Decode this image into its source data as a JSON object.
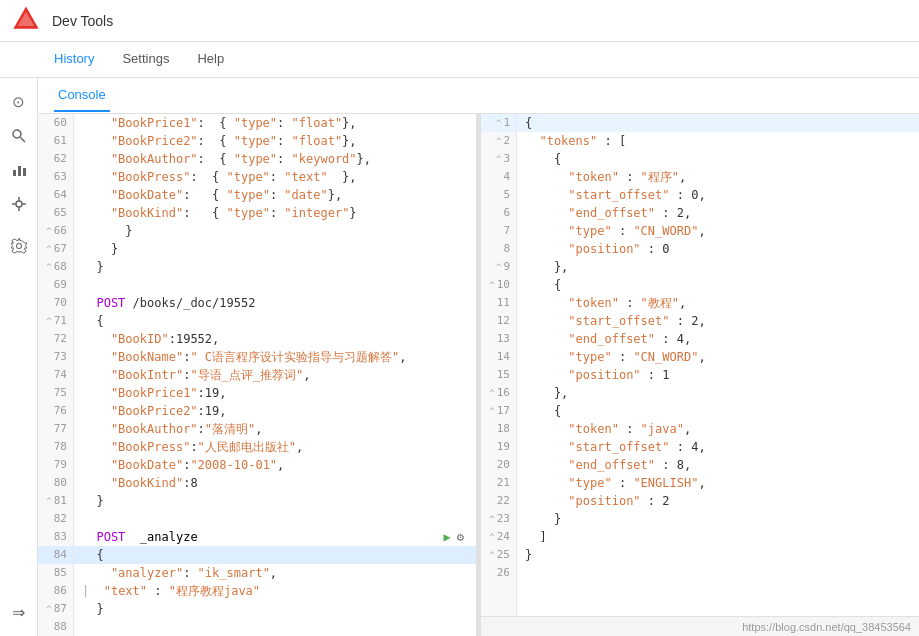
{
  "topbar": {
    "title": "Dev Tools"
  },
  "nav": {
    "items": [
      {
        "label": "History",
        "active": true
      },
      {
        "label": "Settings",
        "active": false
      },
      {
        "label": "Help",
        "active": false
      }
    ]
  },
  "sidebar": {
    "icons": [
      {
        "name": "clock-icon",
        "symbol": "⊙",
        "active": false
      },
      {
        "name": "search-icon",
        "symbol": "⌕",
        "active": false
      },
      {
        "name": "chart-icon",
        "symbol": "⊞",
        "active": false
      },
      {
        "name": "wrench-icon",
        "symbol": "⚙",
        "active": false
      },
      {
        "name": "settings-icon",
        "symbol": "⚙",
        "active": false
      }
    ],
    "bottom_icon": {
      "name": "arrow-right-icon",
      "symbol": "⇒"
    }
  },
  "console": {
    "tab_label": "Console"
  },
  "left_editor": {
    "lines": [
      {
        "num": 60,
        "arrow": null,
        "code": "    \"BookPrice1\":  { \"type\": \"float\"},"
      },
      {
        "num": 61,
        "arrow": null,
        "code": "    \"BookPrice2\":  { \"type\": \"float\"},"
      },
      {
        "num": 62,
        "arrow": null,
        "code": "    \"BookAuthor\":  { \"type\": \"keyword\"},"
      },
      {
        "num": 63,
        "arrow": null,
        "code": "    \"BookPress\":  { \"type\": \"text\"  },"
      },
      {
        "num": 64,
        "arrow": null,
        "code": "    \"BookDate\":   { \"type\": \"date\"},"
      },
      {
        "num": 65,
        "arrow": null,
        "code": "    \"BookKind\":   { \"type\": \"integer\"}"
      },
      {
        "num": 66,
        "arrow": "^",
        "code": "      }"
      },
      {
        "num": 67,
        "arrow": "^",
        "code": "    }"
      },
      {
        "num": 68,
        "arrow": "^",
        "code": "  }"
      },
      {
        "num": 69,
        "arrow": null,
        "code": ""
      },
      {
        "num": 70,
        "arrow": null,
        "code": "  POST /books/_doc/19552"
      },
      {
        "num": 71,
        "arrow": "^",
        "code": "  {"
      },
      {
        "num": 72,
        "arrow": null,
        "code": "    \"BookID\":19552,"
      },
      {
        "num": 73,
        "arrow": null,
        "code": "    \"BookName\":\" C语言程序设计实验指导与习题解答\","
      },
      {
        "num": 74,
        "arrow": null,
        "code": "    \"BookIntr\":\"导语_点评_推荐词\","
      },
      {
        "num": 75,
        "arrow": null,
        "code": "    \"BookPrice1\":19,"
      },
      {
        "num": 76,
        "arrow": null,
        "code": "    \"BookPrice2\":19,"
      },
      {
        "num": 77,
        "arrow": null,
        "code": "    \"BookAuthor\":\"落清明\","
      },
      {
        "num": 78,
        "arrow": null,
        "code": "    \"BookPress\":\"人民邮电出版社\","
      },
      {
        "num": 79,
        "arrow": null,
        "code": "    \"BookDate\":\"2008-10-01\","
      },
      {
        "num": 80,
        "arrow": null,
        "code": "    \"BookKind\":8"
      },
      {
        "num": 81,
        "arrow": "^",
        "code": "  }"
      },
      {
        "num": 82,
        "arrow": null,
        "code": ""
      },
      {
        "num": 83,
        "arrow": null,
        "code": "  POST  _analyze"
      },
      {
        "num": 84,
        "arrow": null,
        "code": "  {",
        "active": true
      },
      {
        "num": 85,
        "arrow": null,
        "code": "    \"analyzer\": \"ik_smart\","
      },
      {
        "num": 86,
        "arrow": null,
        "code": "  | \"text\" : \"程序教程java\""
      },
      {
        "num": 87,
        "arrow": "^",
        "code": "  }"
      },
      {
        "num": 88,
        "arrow": null,
        "code": ""
      }
    ],
    "play_button": "▶",
    "settings_button": "⚙"
  },
  "right_editor": {
    "lines": [
      {
        "num": 1,
        "arrow": "^",
        "code": "{"
      },
      {
        "num": 2,
        "arrow": "^",
        "code": "  \"tokens\" : ["
      },
      {
        "num": 3,
        "arrow": "^",
        "code": "    {"
      },
      {
        "num": 4,
        "arrow": null,
        "code": "      \"token\" : \"程序\","
      },
      {
        "num": 5,
        "arrow": null,
        "code": "      \"start_offset\" : 0,"
      },
      {
        "num": 6,
        "arrow": null,
        "code": "      \"end_offset\" : 2,"
      },
      {
        "num": 7,
        "arrow": null,
        "code": "      \"type\" : \"CN_WORD\","
      },
      {
        "num": 8,
        "arrow": null,
        "code": "      \"position\" : 0"
      },
      {
        "num": 9,
        "arrow": "^",
        "code": "    },"
      },
      {
        "num": 10,
        "arrow": "^",
        "code": "    {"
      },
      {
        "num": 11,
        "arrow": null,
        "code": "      \"token\" : \"教程\","
      },
      {
        "num": 12,
        "arrow": null,
        "code": "      \"start_offset\" : 2,"
      },
      {
        "num": 13,
        "arrow": null,
        "code": "      \"end_offset\" : 4,"
      },
      {
        "num": 14,
        "arrow": null,
        "code": "      \"type\" : \"CN_WORD\","
      },
      {
        "num": 15,
        "arrow": null,
        "code": "      \"position\" : 1"
      },
      {
        "num": 16,
        "arrow": "^",
        "code": "    },"
      },
      {
        "num": 17,
        "arrow": "^",
        "code": "    {"
      },
      {
        "num": 18,
        "arrow": null,
        "code": "      \"token\" : \"java\","
      },
      {
        "num": 19,
        "arrow": null,
        "code": "      \"start_offset\" : 4,"
      },
      {
        "num": 20,
        "arrow": null,
        "code": "      \"end_offset\" : 8,"
      },
      {
        "num": 21,
        "arrow": null,
        "code": "      \"type\" : \"ENGLISH\","
      },
      {
        "num": 22,
        "arrow": null,
        "code": "      \"position\" : 2"
      },
      {
        "num": 23,
        "arrow": "^",
        "code": "    }"
      },
      {
        "num": 24,
        "arrow": "^",
        "code": "  ]"
      },
      {
        "num": 25,
        "arrow": "^",
        "code": "}"
      },
      {
        "num": 26,
        "arrow": null,
        "code": ""
      }
    ]
  },
  "status_bar": {
    "url": "https://blog.csdn.net/qq_38453564"
  }
}
